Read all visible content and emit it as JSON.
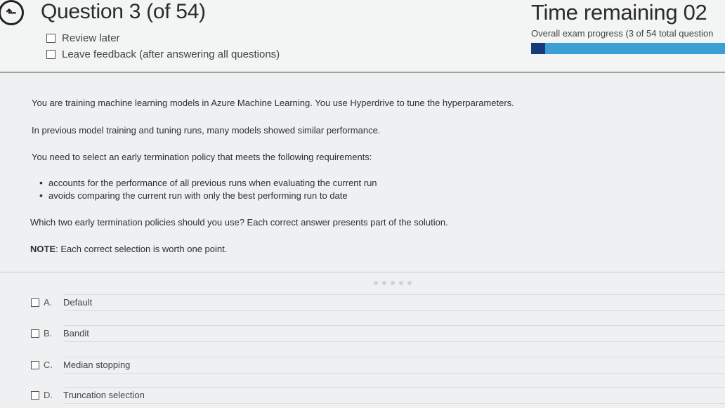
{
  "header": {
    "back_icon": "back-arrow-icon",
    "question_title": "Question 3 (of 54)",
    "review_later_label": "Review later",
    "leave_feedback_label": "Leave feedback (after answering all questions)",
    "time_label": "Time remaining 02",
    "progress_label": "Overall exam progress (3 of 54 total question",
    "progress_fraction": 0.072,
    "progress_color": "#3b9fd4",
    "progress_fill_color": "#173b7a"
  },
  "question": {
    "p1": "You are training machine learning models in Azure Machine Learning. You use Hyperdrive to tune the hyperparameters.",
    "p2": "In previous model training and tuning runs, many models showed similar performance.",
    "p3": "You need to select an early termination policy that meets the following requirements:",
    "bullets": [
      "accounts for the performance of all previous runs when evaluating the current run",
      "avoids comparing the current run with only the best performing run to date"
    ],
    "p4": "Which two early termination policies should you use? Each correct answer presents part of the solution.",
    "note_label": "NOTE",
    "note_text": ": Each correct selection is worth one point."
  },
  "answers": [
    {
      "letter": "A.",
      "text": "Default"
    },
    {
      "letter": "B.",
      "text": "Bandit"
    },
    {
      "letter": "C.",
      "text": "Median stopping"
    },
    {
      "letter": "D.",
      "text": "Truncation selection"
    }
  ]
}
